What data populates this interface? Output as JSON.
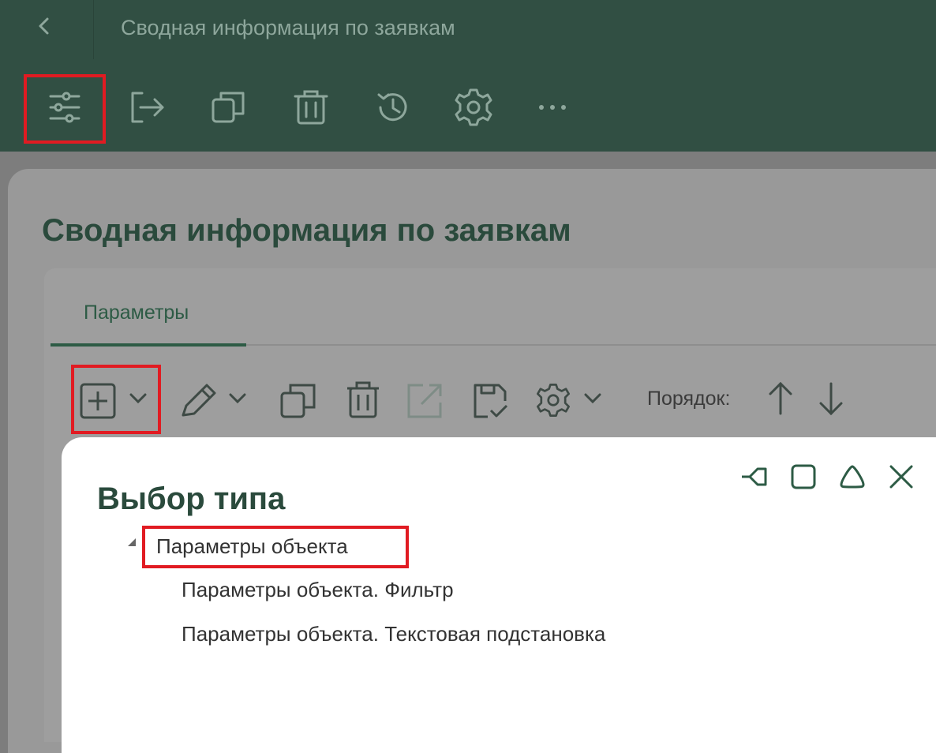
{
  "window": {
    "title": "Сводная информация по заявкам"
  },
  "toolbar": {
    "icons": [
      "settings-sliders-icon",
      "exit-icon",
      "copy-icon",
      "trash-icon",
      "history-icon",
      "gear-icon",
      "more-icon"
    ]
  },
  "page": {
    "title": "Сводная информация по заявкам",
    "tabs": [
      {
        "label": "Параметры",
        "active": true
      }
    ]
  },
  "params_toolbar": {
    "order_label": "Порядок:",
    "icons": [
      "add-icon",
      "edit-icon",
      "copy-icon",
      "trash-icon",
      "open-external-icon",
      "save-icon",
      "gear-icon",
      "arrow-up-icon",
      "arrow-down-icon"
    ]
  },
  "dialog": {
    "title": "Выбор типа",
    "tree": {
      "root": "Параметры объекта",
      "children": [
        "Параметры объекта. Фильтр",
        "Параметры объекта. Текстовая подстановка"
      ]
    }
  },
  "colors": {
    "header_bg": "#314f43",
    "accent_green": "#2d5b45",
    "highlight_red": "#e11b22"
  }
}
